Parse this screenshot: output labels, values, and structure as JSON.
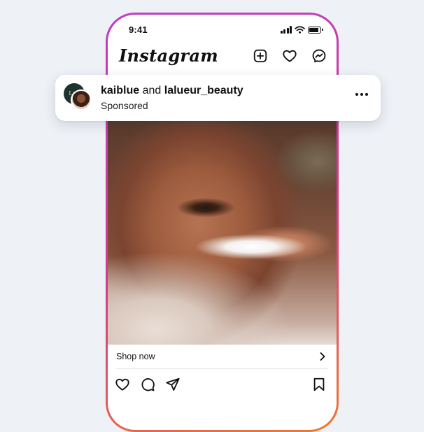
{
  "status_bar": {
    "time": "9:41"
  },
  "header": {
    "logo": "Instagram"
  },
  "card": {
    "brand_avatar_text": "LaL",
    "account_1": "kaiblue",
    "connector": "and",
    "account_2": "lalueur_beauty",
    "subtitle": "Sponsored"
  },
  "post": {
    "cta_label": "Shop now"
  },
  "colors": {
    "frame_gradient": [
      "#c13cc6",
      "#d53a8c",
      "#f07a2e"
    ],
    "brand_avatar_bg": "#1c3330"
  },
  "icons": [
    "signal-icon",
    "wifi-icon",
    "battery-icon",
    "new-post-icon",
    "heart-icon",
    "messenger-icon",
    "more-icon",
    "chevron-right-icon",
    "like-icon",
    "comment-icon",
    "share-icon",
    "bookmark-icon"
  ]
}
